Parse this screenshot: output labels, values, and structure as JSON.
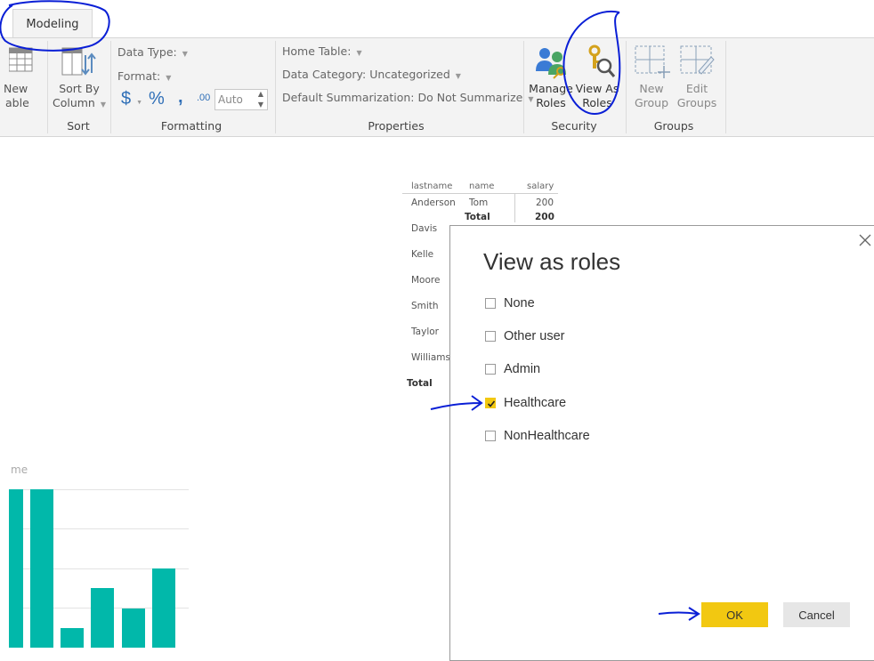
{
  "tab": {
    "label": "Modeling"
  },
  "ribbon": {
    "new_table": {
      "line1": "New",
      "line2": "able"
    },
    "sort_by_column": {
      "line1": "Sort By",
      "line2": "Column"
    },
    "formatting": {
      "data_type": "Data Type:",
      "format": "Format:",
      "currency": "$",
      "percent": "%",
      "comma": ",",
      "decimal": ".00",
      "auto": "Auto"
    },
    "properties": {
      "home_table": "Home Table:",
      "data_category": "Data Category: Uncategorized",
      "default_summarization": "Default Summarization: Do Not Summarize"
    },
    "security": {
      "manage_roles": {
        "line1": "Manage",
        "line2": "Roles"
      },
      "view_as_roles": {
        "line1": "View As",
        "line2": "Roles"
      }
    },
    "groups": {
      "new_group": {
        "line1": "New",
        "line2": "Group"
      },
      "edit_groups": {
        "line1": "Edit",
        "line2": "Groups"
      }
    },
    "group_labels": {
      "sort": "Sort",
      "formatting": "Formatting",
      "properties": "Properties",
      "security": "Security",
      "groups": "Groups"
    }
  },
  "table": {
    "headers": [
      "lastname",
      "name",
      "salary"
    ],
    "rows": [
      "Anderson",
      "Davis",
      "Kelle",
      "Moore",
      "Smith",
      "Taylor",
      "Williams"
    ],
    "anderson_name": "Tom",
    "anderson_salary": "200",
    "subtotal_label": "Total",
    "subtotal_value": "200",
    "grand_total_label": "Total"
  },
  "chart": {
    "title_fragment": "me"
  },
  "chart_data": {
    "type": "bar",
    "title": "me",
    "categories": [
      "",
      "",
      "",
      "",
      "",
      ""
    ],
    "values": [
      4,
      4,
      0.5,
      1.5,
      1,
      2
    ],
    "ylim": [
      0,
      4
    ],
    "grid": true,
    "color": "#01b8aa"
  },
  "dialog": {
    "title": "View as roles",
    "options": [
      {
        "label": "None",
        "checked": false
      },
      {
        "label": "Other user",
        "checked": false
      },
      {
        "label": "Admin",
        "checked": false
      },
      {
        "label": "Healthcare",
        "checked": true
      },
      {
        "label": "NonHealthcare",
        "checked": false
      }
    ],
    "ok": "OK",
    "cancel": "Cancel"
  },
  "colors": {
    "accent": "#f2c811",
    "annotation": "#0a1fd6",
    "bar": "#01b8aa"
  }
}
